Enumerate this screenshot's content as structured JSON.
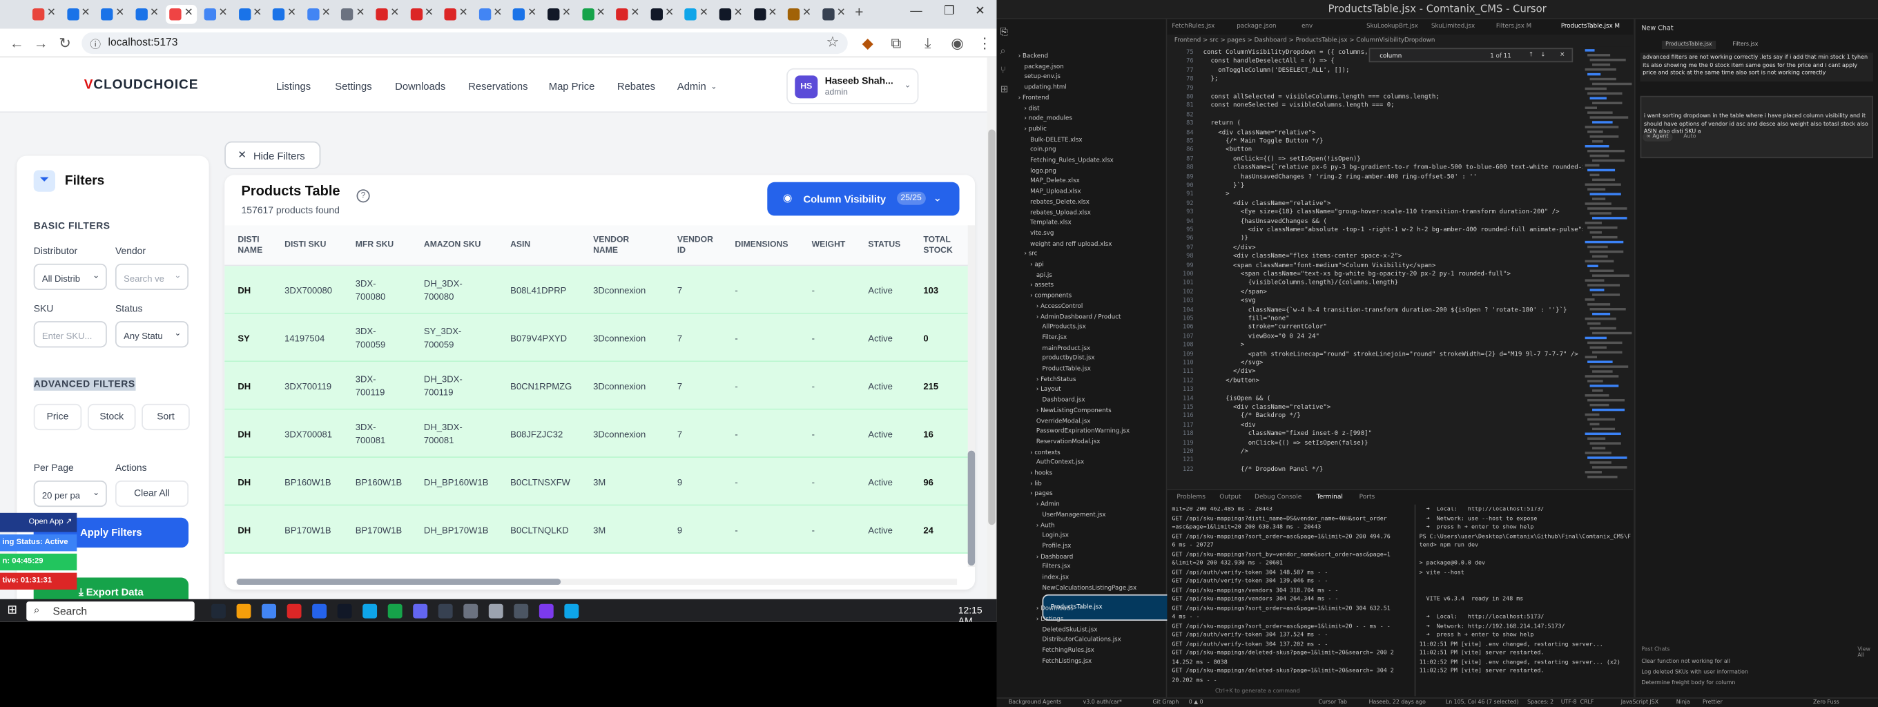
{
  "browser": {
    "url": "localhost:5173",
    "tabs": [
      {
        "color": "#e8453c"
      },
      {
        "color": "#1a73e8"
      },
      {
        "color": "#1a73e8"
      },
      {
        "color": "#1a73e8"
      },
      {
        "color": "#ef4444",
        "active": true
      },
      {
        "color": "#4285f4"
      },
      {
        "color": "#1a73e8"
      },
      {
        "color": "#1a73e8"
      },
      {
        "color": "#4285f4"
      },
      {
        "color": "#6b7280"
      },
      {
        "color": "#dc2626"
      },
      {
        "color": "#dc2626"
      },
      {
        "color": "#dc2626"
      },
      {
        "color": "#4285f4"
      },
      {
        "color": "#1a73e8"
      },
      {
        "color": "#111827"
      },
      {
        "color": "#16a34a"
      },
      {
        "color": "#dc2626"
      },
      {
        "color": "#111827"
      },
      {
        "color": "#0ea5e9"
      },
      {
        "color": "#111827"
      },
      {
        "color": "#111827"
      },
      {
        "color": "#a16207"
      },
      {
        "color": "#374151"
      }
    ],
    "new_tab": "+"
  },
  "app": {
    "logo_v": "V",
    "logo_rest": "CLOUDCHOICE",
    "nav": [
      "Listings",
      "Settings",
      "Downloads",
      "Reservations",
      "Map Price",
      "Rebates",
      "Admin"
    ],
    "user": {
      "initials": "HS",
      "name": "Haseeb Shah...",
      "role": "admin"
    }
  },
  "filters": {
    "title": "Filters",
    "basic_title": "BASIC FILTERS",
    "distributor_label": "Distributor",
    "distributor_value": "All Distrib",
    "vendor_label": "Vendor",
    "vendor_placeholder": "Search ve",
    "sku_label": "SKU",
    "sku_placeholder": "Enter SKU...",
    "status_label": "Status",
    "status_value": "Any Statu",
    "advanced_title": "ADVANCED FILTERS",
    "adv_buttons": [
      "Price",
      "Stock",
      "Sort"
    ],
    "per_page_label": "Per Page",
    "per_page_value": "20 per pa",
    "actions_label": "Actions",
    "clear_all": "Clear All",
    "apply": "Apply Filters",
    "export": "Export Data"
  },
  "ext_overlay": {
    "open_app": "Open App ↗",
    "status": "ing Status: Active",
    "time1": "n: 04:45:29",
    "time2": "tive: 01:31:31"
  },
  "table": {
    "hide_filters": "Hide Filters",
    "title": "Products Table",
    "subtitle": "157617 products found",
    "colvis_label": "Column Visibility",
    "colvis_count": "25/25",
    "headers": [
      [
        "DISTI",
        "NAME"
      ],
      [
        "DISTI SKU"
      ],
      [
        "MFR SKU"
      ],
      [
        "AMAZON SKU"
      ],
      [
        "ASIN"
      ],
      [
        "VENDOR",
        "NAME"
      ],
      [
        "VENDOR",
        "ID"
      ],
      [
        "DIMENSIONS"
      ],
      [
        "WEIGHT"
      ],
      [
        "STATUS"
      ],
      [
        "TOTAL",
        "STOCK"
      ]
    ],
    "rows": [
      {
        "disti": "DH",
        "disti_sku": "3DX700080",
        "mfr_sku": [
          "3DX-",
          "700080"
        ],
        "amazon_sku": [
          "DH_3DX-",
          "700080"
        ],
        "asin": "B08L41DPRP",
        "vendor": "3Dconnexion",
        "vendor_id": "7",
        "dims": "-",
        "weight": "-",
        "status": "Active",
        "stock": "103"
      },
      {
        "disti": "SY",
        "disti_sku": "14197504",
        "mfr_sku": [
          "3DX-",
          "700059"
        ],
        "amazon_sku": [
          "SY_3DX-",
          "700059"
        ],
        "asin": "B079V4PXYD",
        "vendor": "3Dconnexion",
        "vendor_id": "7",
        "dims": "-",
        "weight": "-",
        "status": "Active",
        "stock": "0"
      },
      {
        "disti": "DH",
        "disti_sku": "3DX700119",
        "mfr_sku": [
          "3DX-",
          "700119"
        ],
        "amazon_sku": [
          "DH_3DX-",
          "700119"
        ],
        "asin": "B0CN1RPMZG",
        "vendor": "3Dconnexion",
        "vendor_id": "7",
        "dims": "-",
        "weight": "-",
        "status": "Active",
        "stock": "215"
      },
      {
        "disti": "DH",
        "disti_sku": "3DX700081",
        "mfr_sku": [
          "3DX-",
          "700081"
        ],
        "amazon_sku": [
          "DH_3DX-",
          "700081"
        ],
        "asin": "B08JFZJC32",
        "vendor": "3Dconnexion",
        "vendor_id": "7",
        "dims": "-",
        "weight": "-",
        "status": "Active",
        "stock": "16"
      },
      {
        "disti": "DH",
        "disti_sku": "BP160W1B",
        "mfr_sku": [
          "BP160W1B"
        ],
        "amazon_sku": [
          "DH_BP160W1B"
        ],
        "asin": "B0CLTNSXFW",
        "vendor": "3M",
        "vendor_id": "9",
        "dims": "-",
        "weight": "-",
        "status": "Active",
        "stock": "96"
      },
      {
        "disti": "DH",
        "disti_sku": "BP170W1B",
        "mfr_sku": [
          "BP170W1B"
        ],
        "amazon_sku": [
          "DH_BP170W1B"
        ],
        "asin": "B0CLTNQLKD",
        "vendor": "3M",
        "vendor_id": "9",
        "dims": "-",
        "weight": "-",
        "status": "Active",
        "stock": "24"
      }
    ]
  },
  "taskbar": {
    "search": "Search",
    "time": "12:15 AM"
  },
  "vscode": {
    "title": "ProductsTable.jsx - Comtanix_CMS - Cursor",
    "tabs": [
      "FetchRules.jsx",
      "package.json",
      "env",
      "SkuLookupBrt.jsx",
      "SkuLimited.jsx",
      "Filters.jsx M",
      "ProductsTable.jsx M"
    ],
    "breadcrumb": "Frontend > src > pages > Dashboard > ProductsTable.jsx > ColumnVisibilityDropdown",
    "find_query": "column",
    "find_count": "1 of 11",
    "explorer": [
      {
        "t": "Backend",
        "d": 0,
        "dir": true
      },
      {
        "t": "package.json",
        "d": 1
      },
      {
        "t": "setup-env.js",
        "d": 1
      },
      {
        "t": "updating.html",
        "d": 1
      },
      {
        "t": "Frontend",
        "d": 0,
        "dir": true
      },
      {
        "t": "dist",
        "d": 1,
        "dir": true
      },
      {
        "t": "node_modules",
        "d": 1,
        "dir": true
      },
      {
        "t": "public",
        "d": 1,
        "dir": true
      },
      {
        "t": "Bulk-DELETE.xlsx",
        "d": 2
      },
      {
        "t": "coin.png",
        "d": 2
      },
      {
        "t": "Fetching_Rules_Update.xlsx",
        "d": 2
      },
      {
        "t": "logo.png",
        "d": 2
      },
      {
        "t": "MAP_Delete.xlsx",
        "d": 2
      },
      {
        "t": "MAP_Upload.xlsx",
        "d": 2
      },
      {
        "t": "rebates_Delete.xlsx",
        "d": 2
      },
      {
        "t": "rebates_Upload.xlsx",
        "d": 2
      },
      {
        "t": "Template.xlsx",
        "d": 2
      },
      {
        "t": "vite.svg",
        "d": 2
      },
      {
        "t": "weight and reff upload.xlsx",
        "d": 2
      },
      {
        "t": "src",
        "d": 1,
        "dir": true
      },
      {
        "t": "api",
        "d": 2,
        "dir": true
      },
      {
        "t": "api.js",
        "d": 3
      },
      {
        "t": "assets",
        "d": 2,
        "dir": true
      },
      {
        "t": "components",
        "d": 2,
        "dir": true
      },
      {
        "t": "AccessControl",
        "d": 3,
        "dir": true
      },
      {
        "t": "AdminDashboard / Product",
        "d": 3,
        "dir": true
      },
      {
        "t": "AllProducts.jsx",
        "d": 4
      },
      {
        "t": "Filter.jsx",
        "d": 4
      },
      {
        "t": "mainProduct.jsx",
        "d": 4
      },
      {
        "t": "productbyDist.jsx",
        "d": 4
      },
      {
        "t": "ProductTable.jsx",
        "d": 4
      },
      {
        "t": "FetchStatus",
        "d": 3,
        "dir": true
      },
      {
        "t": "Layout",
        "d": 3,
        "dir": true
      },
      {
        "t": "Dashboard.jsx",
        "d": 4
      },
      {
        "t": "NewListingComponents",
        "d": 3,
        "dir": true
      },
      {
        "t": "OverrideModal.jsx",
        "d": 3
      },
      {
        "t": "PasswordExpirationWarning.jsx",
        "d": 3
      },
      {
        "t": "ReservationModal.jsx",
        "d": 3
      },
      {
        "t": "contexts",
        "d": 2,
        "dir": true
      },
      {
        "t": "AuthContext.jsx",
        "d": 3
      },
      {
        "t": "hooks",
        "d": 2,
        "dir": true
      },
      {
        "t": "lib",
        "d": 2,
        "dir": true
      },
      {
        "t": "pages",
        "d": 2,
        "dir": true
      },
      {
        "t": "Admin",
        "d": 3,
        "dir": true
      },
      {
        "t": "UserManagement.jsx",
        "d": 4
      },
      {
        "t": "Auth",
        "d": 3,
        "dir": true
      },
      {
        "t": "Login.jsx",
        "d": 4
      },
      {
        "t": "Profile.jsx",
        "d": 4
      },
      {
        "t": "Dashboard",
        "d": 3,
        "dir": true
      },
      {
        "t": "Filters.jsx",
        "d": 4
      },
      {
        "t": "index.jsx",
        "d": 4
      },
      {
        "t": "NewCalculationsListingPage.jsx",
        "d": 4
      },
      {
        "t": "ProductsTable.jsx",
        "d": 4,
        "sel": true
      },
      {
        "t": "Downloads",
        "d": 3,
        "dir": true
      },
      {
        "t": "Listings",
        "d": 3,
        "dir": true
      },
      {
        "t": "DeletedSkuList.jsx",
        "d": 4
      },
      {
        "t": "DistributorCalculations.jsx",
        "d": 4
      },
      {
        "t": "FetchingRules.jsx",
        "d": 4
      },
      {
        "t": "FetchListings.jsx",
        "d": 4
      }
    ],
    "code_start_line": 75,
    "code": [
      "const ColumnVisibilityDropdown = ({ columns, visibleCo",
      "  const handleDeselectAll = () => {",
      "    onToggleColumn('DESELECT_ALL', []);",
      "  };",
      "",
      "  const allSelected = visibleColumns.length === columns.length;",
      "  const noneSelected = visibleColumns.length === 0;",
      "",
      "  return (",
      "    <div className=\"relative\">",
      "      {/* Main Toggle Button */}",
      "      <button",
      "        onClick={() => setIsOpen(!isOpen)}",
      "        className={`relative px-6 py-3 bg-gradient-to-r from-blue-500 to-blue-600 text-white rounded-xl",
      "          hasUnsavedChanges ? 'ring-2 ring-amber-400 ring-offset-50' : ''",
      "        }`}",
      "      >",
      "        <div className=\"relative\">",
      "          <Eye size={18} className=\"group-hover:scale-110 transition-transform duration-200\" />",
      "          {hasUnsavedChanges && (",
      "            <div className=\"absolute -top-1 -right-1 w-2 h-2 bg-amber-400 rounded-full animate-pulse\"></div>",
      "          )}",
      "        </div>",
      "        <div className=\"flex items-center space-x-2\">",
      "        <span className=\"font-medium\">Column Visibility</span>",
      "          <span className=\"text-xs bg-white bg-opacity-20 px-2 py-1 rounded-full\">",
      "            {visibleColumns.length}/{columns.length}",
      "          </span>",
      "          <svg",
      "            className={`w-4 h-4 transition-transform duration-200 ${isOpen ? 'rotate-180' : ''}`}",
      "            fill=\"none\"",
      "            stroke=\"currentColor\"",
      "            viewBox=\"0 0 24 24\"",
      "          >",
      "            <path strokeLinecap=\"round\" strokeLinejoin=\"round\" strokeWidth={2} d=\"M19 9l-7 7-7-7\" />",
      "          </svg>",
      "        </div>",
      "      </button>",
      "",
      "      {isOpen && (",
      "        <div className=\"relative\">",
      "          {/* Backdrop */}",
      "          <div",
      "            className=\"fixed inset-0 z-[998]\"",
      "            onClick={() => setIsOpen(false)}",
      "          />",
      "",
      "          {/* Dropdown Panel */}"
    ],
    "panel_tabs": [
      "Problems",
      "Output",
      "Debug Console",
      "Terminal",
      "Ports"
    ],
    "term_left": [
      "mit=20 200 462.485 ms - 20443",
      "GET /api/sku-mappings?disti_name=DS&vendor_name=40H&sort_order",
      "=asc&page=1&limit=20 200 630.348 ms - 20443",
      "GET /api/sku-mappings?sort_order=asc&page=1&limit=20 200 494.76",
      "6 ms - 20727",
      "GET /api/sku-mappings?sort_by=vendor_name&sort_order=asc&page=1",
      "&limit=20 200 432.930 ms - 20601",
      "GET /api/auth/verify-token 304 148.587 ms - -",
      "GET /api/auth/verify-token 304 139.046 ms - -",
      "GET /api/sku-mappings/vendors 304 318.704 ms - -",
      "GET /api/sku-mappings/vendors 304 264.344 ms - -",
      "GET /api/sku-mappings?sort_order=asc&page=1&limit=20 304 632.51",
      "4 ms - -",
      "GET /api/sku-mappings?sort_order=asc&page=1&limit=20 - - ms - -",
      "GET /api/auth/verify-token 304 137.524 ms - -",
      "GET /api/auth/verify-token 304 137.202 ms - -",
      "GET /api/sku-mappings/deleted-skus?page=1&limit=20&search= 200 2",
      "14.252 ms - 8038",
      "GET /api/sku-mappings/deleted-skus?page=1&limit=20&search= 304 2",
      "20.202 ms - -"
    ],
    "term_right": [
      "  ➜  Local:   http://localhost:5173/",
      "  ➜  Network: use --host to expose",
      "  ➜  press h + enter to show help",
      "PS C:\\Users\\user\\Desktop\\Comtanix\\Github\\Final\\Comtanix_CMS\\Fron",
      "tend> npm run dev",
      "",
      "> package@0.0.0 dev",
      "> vite --host",
      "",
      "",
      "  VITE v6.3.4  ready in 248 ms",
      "",
      "  ➜  Local:   http://localhost:5173/",
      "  ➜  Network: http://192.168.214.147:5173/",
      "  ➜  press h + enter to show help",
      "11:02:51 PM [vite] .env changed, restarting server...",
      "11:02:51 PM [vite] server restarted.",
      "11:02:52 PM [vite] .env changed, restarting server... (x2)",
      "11:02:52 PM [vite] server restarted."
    ],
    "term_hint": "Ctrl+K to generate a command",
    "chat": {
      "header": "New Chat",
      "tabs": [
        "ProductsTable.jsx",
        "Filters.jsx"
      ],
      "msg1": "advanced filters are not working correctly .lets say if i add that min stock 1 tyhen its also showing me the 0 stock item same goes for the price and i cant apply price and stock at the same time also sort is not working correctly",
      "msg2": "i want sorting dropdown in the table where i have placed column visibility and it should have options of vendor id asc and desce also weight also totasl stock also ASIN also disti SKU a",
      "agent_label": "∞ Agent",
      "auto_label": "Auto",
      "past_chats": "Past Chats",
      "view_all": "View All",
      "past": [
        "Clear function not working for all",
        "Log deleted SKUs with user information",
        "Determine freight body for column"
      ]
    },
    "status_items": [
      "Background Agents",
      "v3.0 auth/car*",
      "Git Graph",
      "0 ▲ 0",
      "Cursor Tab",
      "Haseeb, 22 days ago",
      "Ln 105, Col 46 (7 selected)",
      "Spaces: 2",
      "UTF-8",
      "CRLF",
      "JavaScript JSX",
      "Ninja",
      "Prettier",
      "Zero Fuss"
    ]
  }
}
